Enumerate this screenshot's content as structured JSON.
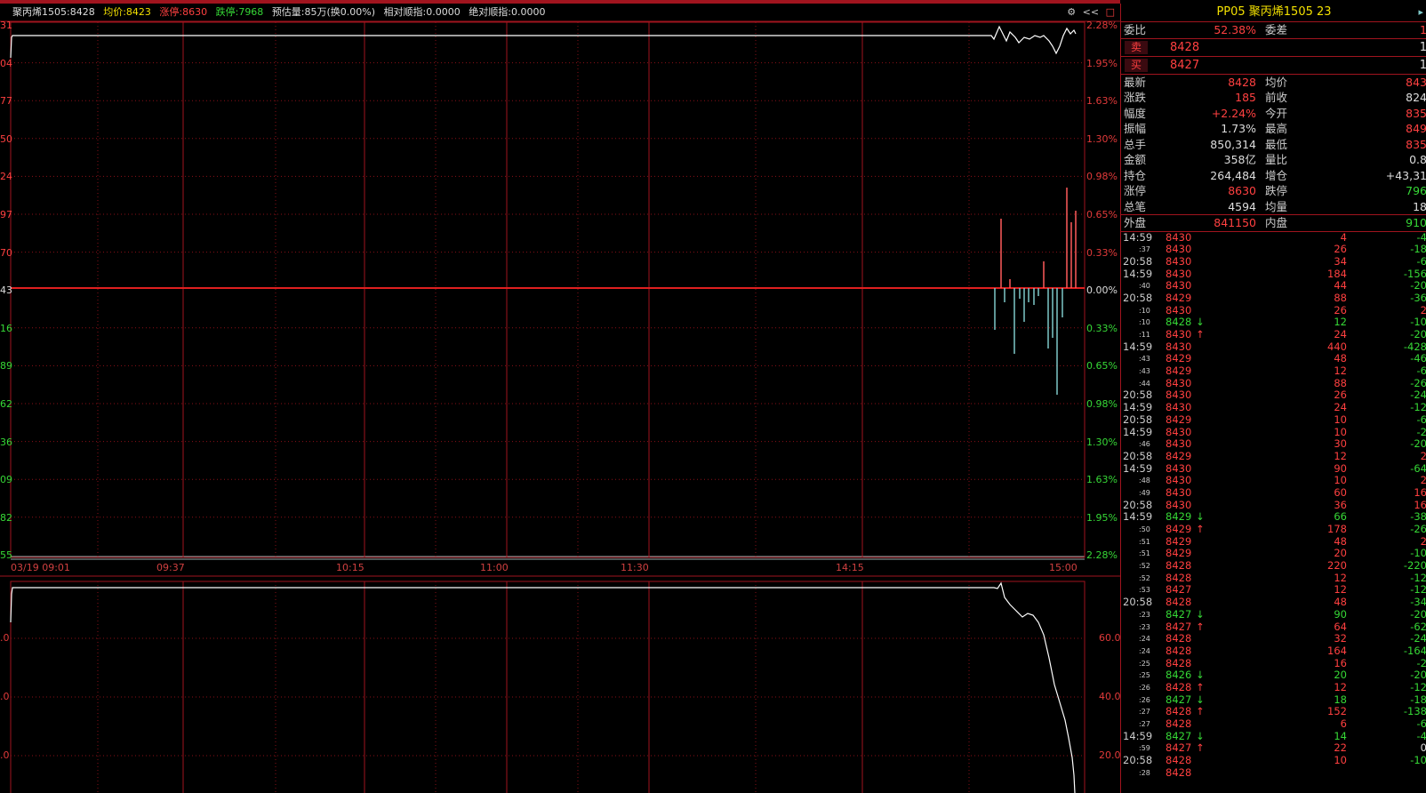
{
  "header": {
    "symbol_price": "聚丙烯1505:8428",
    "avg": "均价:8423",
    "limit_up": "涨停:8630",
    "limit_down": "跌停:7968",
    "estimate": "预估量:85万(换0.00%)",
    "rel_index": "相对顺指:0.0000",
    "abs_index": "绝对顺指:0.0000",
    "tools": [
      "⚙",
      "<<",
      "□"
    ]
  },
  "price_axis_right": [
    "2.28%",
    "1.95%",
    "1.63%",
    "1.30%",
    "0.98%",
    "0.65%",
    "0.33%",
    "0.00%",
    "0.33%",
    "0.65%",
    "0.98%",
    "1.30%",
    "1.63%",
    "1.95%",
    "2.28%"
  ],
  "price_axis_left_cut": [
    "31",
    "04",
    "77",
    "50",
    "24",
    "97",
    "70",
    "43",
    "16",
    "89",
    "62",
    "36",
    "09",
    "82",
    "55"
  ],
  "time_axis": [
    "03/19 09:01",
    "09:37",
    "10:15",
    "11:00",
    "11:30",
    "14:15",
    "15:00"
  ],
  "lower_axis": [
    "60.0",
    "40.0",
    "20.0"
  ],
  "lower_axis_left_cut": [
    ".0",
    ".0",
    ".0"
  ],
  "colors": {
    "up": "#ff4040",
    "down": "#36d836",
    "grid": "#a0141e",
    "price_line": "#ffffff",
    "vol_down": "#7ec8c8"
  },
  "quote": {
    "title": "PP05  聚丙烯1505  23",
    "wb": {
      "l1": "委比",
      "v1": "52.38%",
      "l2": "委差",
      "v2": "1"
    },
    "sell": {
      "tag": "卖",
      "price": "8428",
      "qty": "1"
    },
    "buy": {
      "tag": "买",
      "price": "8427",
      "qty": "1"
    },
    "stats": [
      {
        "l1": "最新",
        "v1": "8428",
        "c1": "red",
        "l2": "均价",
        "v2": "843",
        "c2": "red"
      },
      {
        "l1": "涨跌",
        "v1": "185",
        "c1": "red",
        "l2": "前收",
        "v2": "824",
        "c2": "white"
      },
      {
        "l1": "幅度",
        "v1": "+2.24%",
        "c1": "red",
        "l2": "今开",
        "v2": "835",
        "c2": "red"
      },
      {
        "l1": "振幅",
        "v1": "1.73%",
        "c1": "white",
        "l2": "最高",
        "v2": "849",
        "c2": "red"
      },
      {
        "l1": "总手",
        "v1": "850,314",
        "c1": "white",
        "l2": "最低",
        "v2": "835",
        "c2": "red"
      },
      {
        "l1": "金额",
        "v1": "358亿",
        "c1": "white",
        "l2": "量比",
        "v2": "0.8",
        "c2": "white"
      },
      {
        "l1": "持仓",
        "v1": "264,484",
        "c1": "white",
        "l2": "增仓",
        "v2": "+43,31",
        "c2": "white"
      },
      {
        "l1": "涨停",
        "v1": "8630",
        "c1": "red",
        "l2": "跌停",
        "v2": "796",
        "c2": "green"
      },
      {
        "l1": "总笔",
        "v1": "4594",
        "c1": "white",
        "l2": "均量",
        "v2": "18",
        "c2": "white"
      }
    ],
    "outer": {
      "l1": "外盘",
      "v1": "841150",
      "l2": "内盘",
      "v2": "910"
    }
  },
  "ticks": [
    {
      "t": "14:59",
      "small": false,
      "p": "8430",
      "a": "",
      "v": "4",
      "d": "-4",
      "vc": "red",
      "dc": "green"
    },
    {
      "t": ":37",
      "small": true,
      "p": "8430",
      "a": "",
      "v": "26",
      "d": "-18",
      "vc": "red",
      "dc": "green"
    },
    {
      "t": "20:58",
      "small": false,
      "p": "8430",
      "a": "",
      "v": "34",
      "d": "-6",
      "vc": "red",
      "dc": "green"
    },
    {
      "t": "14:59",
      "small": false,
      "p": "8430",
      "a": "",
      "v": "184",
      "d": "-156",
      "vc": "red",
      "dc": "green"
    },
    {
      "t": ":40",
      "small": true,
      "p": "8430",
      "a": "",
      "v": "44",
      "d": "-20",
      "vc": "red",
      "dc": "green"
    },
    {
      "t": "20:58",
      "small": false,
      "p": "8429",
      "a": "",
      "v": "88",
      "d": "-36",
      "vc": "red",
      "dc": "green"
    },
    {
      "t": ":10",
      "small": true,
      "p": "8430",
      "a": "",
      "v": "26",
      "d": "2",
      "vc": "red",
      "dc": "red"
    },
    {
      "t": ":10",
      "small": true,
      "p": "8428",
      "a": "↓",
      "v": "12",
      "d": "-10",
      "vc": "green",
      "dc": "green"
    },
    {
      "t": ":11",
      "small": true,
      "p": "8430",
      "a": "↑",
      "v": "24",
      "d": "-20",
      "vc": "red",
      "dc": "green"
    },
    {
      "t": "14:59",
      "small": false,
      "p": "8430",
      "a": "",
      "v": "440",
      "d": "-428",
      "vc": "red",
      "dc": "green"
    },
    {
      "t": ":43",
      "small": true,
      "p": "8429",
      "a": "",
      "v": "48",
      "d": "-46",
      "vc": "red",
      "dc": "green"
    },
    {
      "t": ":43",
      "small": true,
      "p": "8429",
      "a": "",
      "v": "12",
      "d": "-6",
      "vc": "red",
      "dc": "green"
    },
    {
      "t": ":44",
      "small": true,
      "p": "8430",
      "a": "",
      "v": "88",
      "d": "-26",
      "vc": "red",
      "dc": "green"
    },
    {
      "t": "20:58",
      "small": false,
      "p": "8430",
      "a": "",
      "v": "26",
      "d": "-24",
      "vc": "red",
      "dc": "green"
    },
    {
      "t": "14:59",
      "small": false,
      "p": "8430",
      "a": "",
      "v": "24",
      "d": "-12",
      "vc": "red",
      "dc": "green"
    },
    {
      "t": "20:58",
      "small": false,
      "p": "8429",
      "a": "",
      "v": "10",
      "d": "-6",
      "vc": "red",
      "dc": "green"
    },
    {
      "t": "14:59",
      "small": false,
      "p": "8430",
      "a": "",
      "v": "10",
      "d": "-2",
      "vc": "red",
      "dc": "green"
    },
    {
      "t": ":46",
      "small": true,
      "p": "8430",
      "a": "",
      "v": "30",
      "d": "-20",
      "vc": "red",
      "dc": "green"
    },
    {
      "t": "20:58",
      "small": false,
      "p": "8429",
      "a": "",
      "v": "12",
      "d": "2",
      "vc": "red",
      "dc": "red"
    },
    {
      "t": "14:59",
      "small": false,
      "p": "8430",
      "a": "",
      "v": "90",
      "d": "-64",
      "vc": "red",
      "dc": "green"
    },
    {
      "t": ":48",
      "small": true,
      "p": "8430",
      "a": "",
      "v": "10",
      "d": "2",
      "vc": "red",
      "dc": "red"
    },
    {
      "t": ":49",
      "small": true,
      "p": "8430",
      "a": "",
      "v": "60",
      "d": "16",
      "vc": "red",
      "dc": "red"
    },
    {
      "t": "20:58",
      "small": false,
      "p": "8430",
      "a": "",
      "v": "36",
      "d": "16",
      "vc": "red",
      "dc": "red"
    },
    {
      "t": "14:59",
      "small": false,
      "p": "8429",
      "a": "↓",
      "v": "66",
      "d": "-38",
      "vc": "green",
      "dc": "green"
    },
    {
      "t": ":50",
      "small": true,
      "p": "8429",
      "a": "↑",
      "v": "178",
      "d": "-26",
      "vc": "red",
      "dc": "green"
    },
    {
      "t": ":51",
      "small": true,
      "p": "8429",
      "a": "",
      "v": "48",
      "d": "2",
      "vc": "red",
      "dc": "red"
    },
    {
      "t": ":51",
      "small": true,
      "p": "8429",
      "a": "",
      "v": "20",
      "d": "-10",
      "vc": "red",
      "dc": "green"
    },
    {
      "t": ":52",
      "small": true,
      "p": "8428",
      "a": "",
      "v": "220",
      "d": "-220",
      "vc": "red",
      "dc": "green"
    },
    {
      "t": ":52",
      "small": true,
      "p": "8428",
      "a": "",
      "v": "12",
      "d": "-12",
      "vc": "red",
      "dc": "green"
    },
    {
      "t": ":53",
      "small": true,
      "p": "8427",
      "a": "",
      "v": "12",
      "d": "-12",
      "vc": "red",
      "dc": "green"
    },
    {
      "t": "20:58",
      "small": false,
      "p": "8428",
      "a": "",
      "v": "48",
      "d": "-34",
      "vc": "red",
      "dc": "green"
    },
    {
      "t": ":23",
      "small": true,
      "p": "8427",
      "a": "↓",
      "v": "90",
      "d": "-20",
      "vc": "green",
      "dc": "green"
    },
    {
      "t": ":23",
      "small": true,
      "p": "8427",
      "a": "↑",
      "v": "64",
      "d": "-62",
      "vc": "red",
      "dc": "green"
    },
    {
      "t": ":24",
      "small": true,
      "p": "8428",
      "a": "",
      "v": "32",
      "d": "-24",
      "vc": "red",
      "dc": "green"
    },
    {
      "t": ":24",
      "small": true,
      "p": "8428",
      "a": "",
      "v": "164",
      "d": "-164",
      "vc": "red",
      "dc": "green"
    },
    {
      "t": ":25",
      "small": true,
      "p": "8428",
      "a": "",
      "v": "16",
      "d": "-2",
      "vc": "red",
      "dc": "green"
    },
    {
      "t": ":25",
      "small": true,
      "p": "8426",
      "a": "↓",
      "v": "20",
      "d": "-20",
      "vc": "green",
      "dc": "green"
    },
    {
      "t": ":26",
      "small": true,
      "p": "8428",
      "a": "↑",
      "v": "12",
      "d": "-12",
      "vc": "red",
      "dc": "green"
    },
    {
      "t": ":26",
      "small": true,
      "p": "8427",
      "a": "↓",
      "v": "18",
      "d": "-18",
      "vc": "green",
      "dc": "green"
    },
    {
      "t": ":27",
      "small": true,
      "p": "8428",
      "a": "↑",
      "v": "152",
      "d": "-138",
      "vc": "red",
      "dc": "green"
    },
    {
      "t": ":27",
      "small": true,
      "p": "8428",
      "a": "",
      "v": "6",
      "d": "-6",
      "vc": "red",
      "dc": "green"
    },
    {
      "t": "14:59",
      "small": false,
      "p": "8427",
      "a": "↓",
      "v": "14",
      "d": "-4",
      "vc": "green",
      "dc": "green"
    },
    {
      "t": ":59",
      "small": true,
      "p": "8427",
      "a": "↑",
      "v": "22",
      "d": "0",
      "vc": "red",
      "dc": "white"
    },
    {
      "t": "20:58",
      "small": false,
      "p": "8428",
      "a": "",
      "v": "10",
      "d": "-10",
      "vc": "red",
      "dc": "green"
    },
    {
      "t": ":28",
      "small": true,
      "p": "8428",
      "a": "",
      "v": "",
      "d": "",
      "vc": "red",
      "dc": "green"
    }
  ]
}
